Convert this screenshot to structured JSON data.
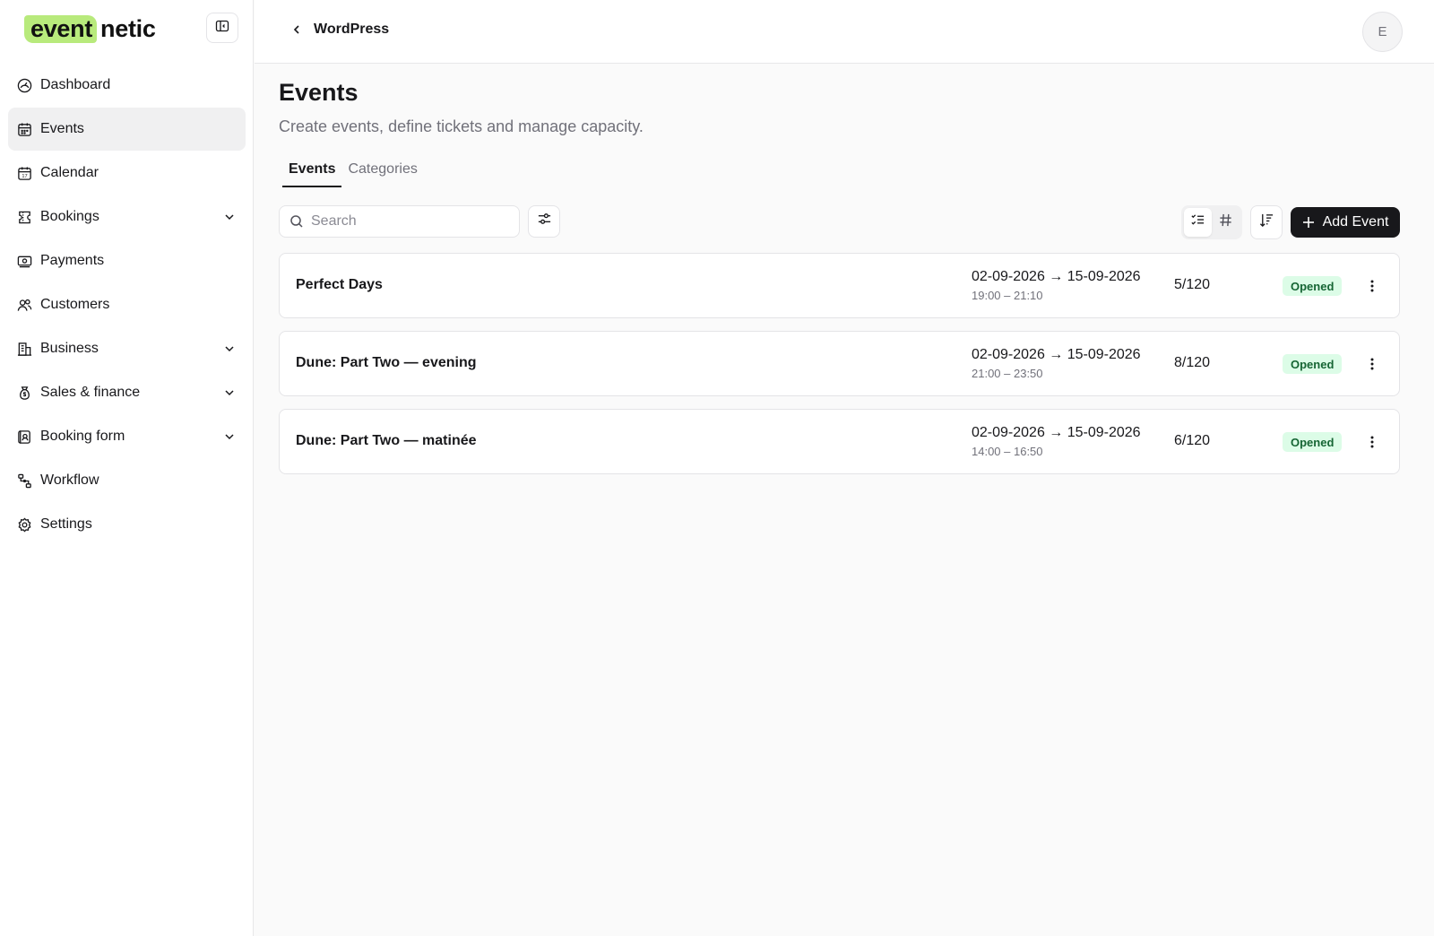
{
  "app": {
    "logo_highlight": "event",
    "logo_rest": "netic"
  },
  "sidebar": {
    "items": [
      {
        "label": "Dashboard",
        "icon": "dashboard-icon"
      },
      {
        "label": "Events",
        "icon": "calendar-grid-icon",
        "active": true
      },
      {
        "label": "Calendar",
        "icon": "calendar-icon"
      },
      {
        "label": "Bookings",
        "icon": "ticket-icon",
        "expandable": true
      },
      {
        "label": "Payments",
        "icon": "money-icon"
      },
      {
        "label": "Customers",
        "icon": "users-icon"
      },
      {
        "label": "Business",
        "icon": "building-icon",
        "expandable": true
      },
      {
        "label": "Sales & finance",
        "icon": "money-bag-icon",
        "expandable": true
      },
      {
        "label": "Booking form",
        "icon": "form-icon",
        "expandable": true
      },
      {
        "label": "Workflow",
        "icon": "workflow-icon"
      },
      {
        "label": "Settings",
        "icon": "gear-icon"
      }
    ]
  },
  "header": {
    "back_label": "WordPress",
    "avatar_initial": "E"
  },
  "main": {
    "title": "Events",
    "subtitle": "Create events, define tickets and manage capacity.",
    "tabs": [
      {
        "label": "Events",
        "active": true
      },
      {
        "label": "Categories",
        "active": false
      }
    ],
    "search_placeholder": "Search",
    "add_button_label": "Add Event"
  },
  "events": [
    {
      "name": "Perfect Days",
      "dates": "02-09-2026 → 15-09-2026",
      "times": "19:00 – 21:10",
      "capacity": "5/120",
      "status": "Opened"
    },
    {
      "name": "Dune: Part Two — evening",
      "dates": "02-09-2026 → 15-09-2026",
      "times": "21:00 – 23:50",
      "capacity": "8/120",
      "status": "Opened"
    },
    {
      "name": "Dune: Part Two — matinée",
      "dates": "02-09-2026 → 15-09-2026",
      "times": "14:00 – 16:50",
      "capacity": "6/120",
      "status": "Opened"
    }
  ],
  "colors": {
    "brand_highlight": "#b8ea7c",
    "primary_button": "#18181b",
    "status_opened_bg": "#dcfce7",
    "status_opened_text": "#166534"
  }
}
